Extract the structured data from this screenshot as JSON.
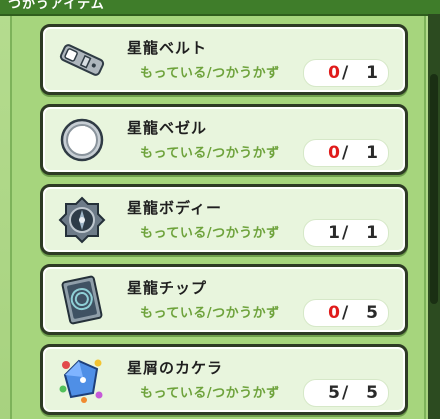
{
  "header": {
    "title": "つかうアイテム"
  },
  "columns": {
    "owned_label": "もっている/つかうかず"
  },
  "items": [
    {
      "name": "星龍ベルト",
      "icon": "belt-icon",
      "have": "0",
      "need": "1",
      "have_color": "#e01b1b"
    },
    {
      "name": "星龍ベゼル",
      "icon": "bezel-ring-icon",
      "have": "0",
      "need": "1",
      "have_color": "#e01b1b"
    },
    {
      "name": "星龍ボディー",
      "icon": "watch-body-icon",
      "have": "1",
      "need": "1",
      "have_color": "#2a2a2a"
    },
    {
      "name": "星龍チップ",
      "icon": "chip-card-icon",
      "have": "0",
      "need": "5",
      "have_color": "#e01b1b"
    },
    {
      "name": "星屑のカケラ",
      "icon": "stardust-shard-icon",
      "have": "5",
      "need": "5",
      "have_color": "#2a2a2a"
    }
  ],
  "colors": {
    "background": "#a6d57d",
    "card": "#e8f5dd",
    "label_green": "#6ea33c",
    "shortage_red": "#e01b1b"
  }
}
